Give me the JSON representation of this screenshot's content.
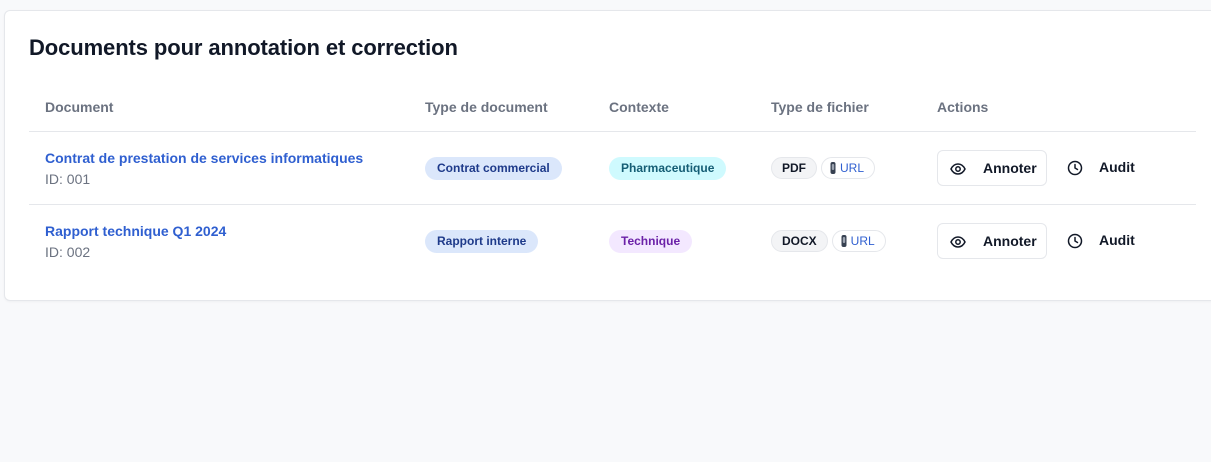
{
  "card": {
    "title": "Documents pour annotation et correction"
  },
  "table": {
    "headers": [
      "Document",
      "Type de document",
      "Contexte",
      "Type de fichier",
      "Actions"
    ],
    "rows": [
      {
        "title": "Contrat de prestation de services informatiques",
        "id": "ID: 001",
        "doc_type": "Contrat commercial",
        "context": "Pharmaceutique",
        "file_type": "PDF",
        "url_label": "URL",
        "annotate_label": "Annoter",
        "audit_label": "Audit"
      },
      {
        "title": "Rapport technique Q1 2024",
        "id": "ID: 002",
        "doc_type": "Rapport interne",
        "context": "Technique",
        "file_type": "DOCX",
        "url_label": "URL",
        "annotate_label": "Annoter",
        "audit_label": "Audit"
      }
    ]
  },
  "icons": {
    "annotate": "eye-icon",
    "audit": "clock-icon",
    "url": "usb-drive-icon"
  },
  "colors": {
    "link": "#2f5fd0",
    "badge_type_bg": "#dbe7fb",
    "badge_pharma_bg": "#cffafe",
    "badge_tech_bg": "#f3e8ff"
  }
}
